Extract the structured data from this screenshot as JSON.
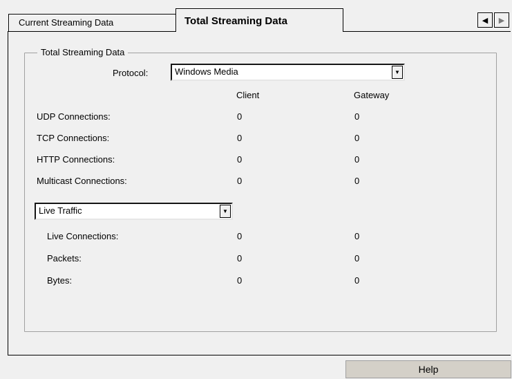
{
  "tabs": {
    "current": "Current Streaming Data",
    "total": "Total Streaming Data"
  },
  "tab_scroll": {
    "left_icon": "triangle-left",
    "right_icon": "triangle-right"
  },
  "group": {
    "caption": "Total Streaming Data"
  },
  "protocol": {
    "label": "Protocol:",
    "selected": "Windows Media"
  },
  "columns": {
    "client": "Client",
    "gateway": "Gateway"
  },
  "connections": [
    {
      "label": "UDP Connections:",
      "client": "0",
      "gateway": "0"
    },
    {
      "label": "TCP Connections:",
      "client": "0",
      "gateway": "0"
    },
    {
      "label": "HTTP Connections:",
      "client": "0",
      "gateway": "0"
    },
    {
      "label": "Multicast Connections:",
      "client": "0",
      "gateway": "0"
    }
  ],
  "traffic": {
    "selected": "Live Traffic"
  },
  "traffic_rows": [
    {
      "label": "Live Connections:",
      "client": "0",
      "gateway": "0"
    },
    {
      "label": "Packets:",
      "client": "0",
      "gateway": "0"
    },
    {
      "label": "Bytes:",
      "client": "0",
      "gateway": "0"
    }
  ],
  "help_label": "Help"
}
